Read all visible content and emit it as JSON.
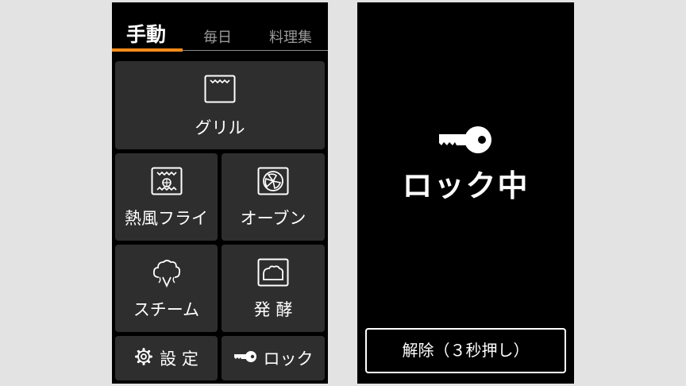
{
  "tabs": [
    {
      "label": "手動",
      "active": true
    },
    {
      "label": "毎日",
      "active": false
    },
    {
      "label": "料理集",
      "active": false
    }
  ],
  "modes": {
    "grill": {
      "label": "グリル",
      "icon": "grill-icon"
    },
    "air_fry": {
      "label": "熱風フライ",
      "icon": "air-fry-icon"
    },
    "oven": {
      "label": "オーブン",
      "icon": "oven-fan-icon"
    },
    "steam": {
      "label": "スチーム",
      "icon": "steam-icon"
    },
    "ferment": {
      "label": "発 酵",
      "icon": "ferment-icon"
    }
  },
  "footer": {
    "settings_label": "設 定",
    "lock_label": "ロック"
  },
  "lock_screen": {
    "title": "ロック中",
    "release_label": "解除（３秒押し）"
  },
  "colors": {
    "accent": "#ff8c1a",
    "panel": "#000000",
    "button": "#2e2e2e",
    "inactive_tab": "#9a9a9a"
  }
}
